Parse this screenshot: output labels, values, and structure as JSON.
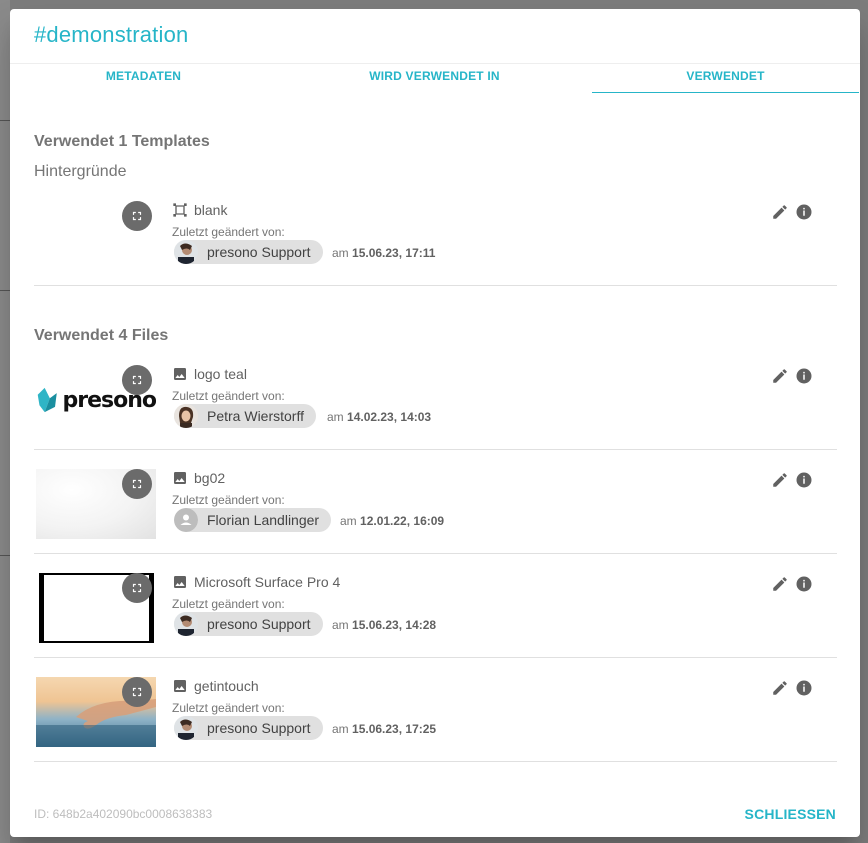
{
  "dialog": {
    "title": "#demonstration"
  },
  "tabs": [
    {
      "label": "METADATEN"
    },
    {
      "label": "WIRD VERWENDET IN"
    },
    {
      "label": "VERWENDET",
      "active": true
    }
  ],
  "templates": {
    "heading": "Verwendet 1 Templates",
    "subheading": "Hintergründe",
    "items": [
      {
        "name": "blank",
        "type_icon": "template-icon",
        "changed_label": "Zuletzt geändert von:",
        "user": "presono Support",
        "date_prefix": "am",
        "date": "15.06.23, 17:11"
      }
    ]
  },
  "files": {
    "heading": "Verwendet 4 Files",
    "items": [
      {
        "name": "logo teal",
        "type_icon": "image-icon",
        "changed_label": "Zuletzt geändert von:",
        "user": "Petra Wierstorff",
        "date_prefix": "am",
        "date": "14.02.23, 14:03",
        "thumb_text": "presono"
      },
      {
        "name": "bg02",
        "type_icon": "image-icon",
        "changed_label": "Zuletzt geändert von:",
        "user": "Florian Landlinger",
        "date_prefix": "am",
        "date": "12.01.22, 16:09"
      },
      {
        "name": "Microsoft Surface Pro 4",
        "type_icon": "image-icon",
        "changed_label": "Zuletzt geändert von:",
        "user": "presono Support",
        "date_prefix": "am",
        "date": "15.06.23, 14:28"
      },
      {
        "name": "getintouch",
        "type_icon": "image-icon",
        "changed_label": "Zuletzt geändert von:",
        "user": "presono Support",
        "date_prefix": "am",
        "date": "15.06.23, 17:25"
      }
    ]
  },
  "footer": {
    "id_text": "ID: 648b2a402090bc0008638383",
    "close_label": "SCHLIESSEN"
  },
  "colors": {
    "accent": "#26b5c8",
    "chip": "#e0e0e0",
    "button_dark": "#6b6b6b",
    "logo_teal": "#2fb5c6"
  }
}
